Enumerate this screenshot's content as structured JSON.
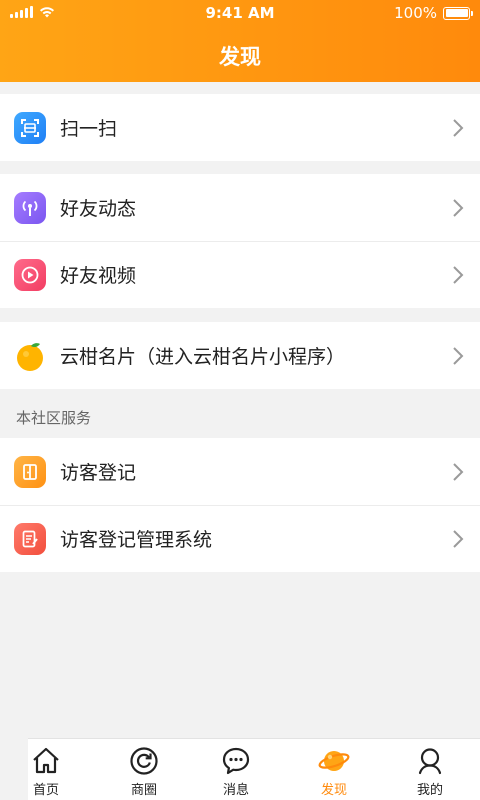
{
  "status_bar": {
    "time": "9:41 AM",
    "battery": "100%"
  },
  "header": {
    "title": "发现"
  },
  "sections": {
    "scan": {
      "label": "扫一扫"
    },
    "friends_feed": {
      "label": "好友动态"
    },
    "friends_video": {
      "label": "好友视频"
    },
    "card": {
      "label": "云柑名片（进入云柑名片小程序）"
    },
    "community_title": "本社区服务",
    "visitor": {
      "label": "访客登记"
    },
    "visitor_admin": {
      "label": "访客登记管理系统"
    }
  },
  "tabbar": {
    "items": [
      {
        "label": "首页",
        "icon": "home-icon"
      },
      {
        "label": "商圈",
        "icon": "refresh-circle-icon"
      },
      {
        "label": "消息",
        "icon": "chat-bubble-icon"
      },
      {
        "label": "发现",
        "icon": "planet-icon",
        "active": true
      },
      {
        "label": "我的",
        "icon": "user-icon"
      }
    ]
  },
  "colors": {
    "accent": "#ff8a0c",
    "header_start": "#ffa515",
    "background": "#f2f2f2"
  }
}
